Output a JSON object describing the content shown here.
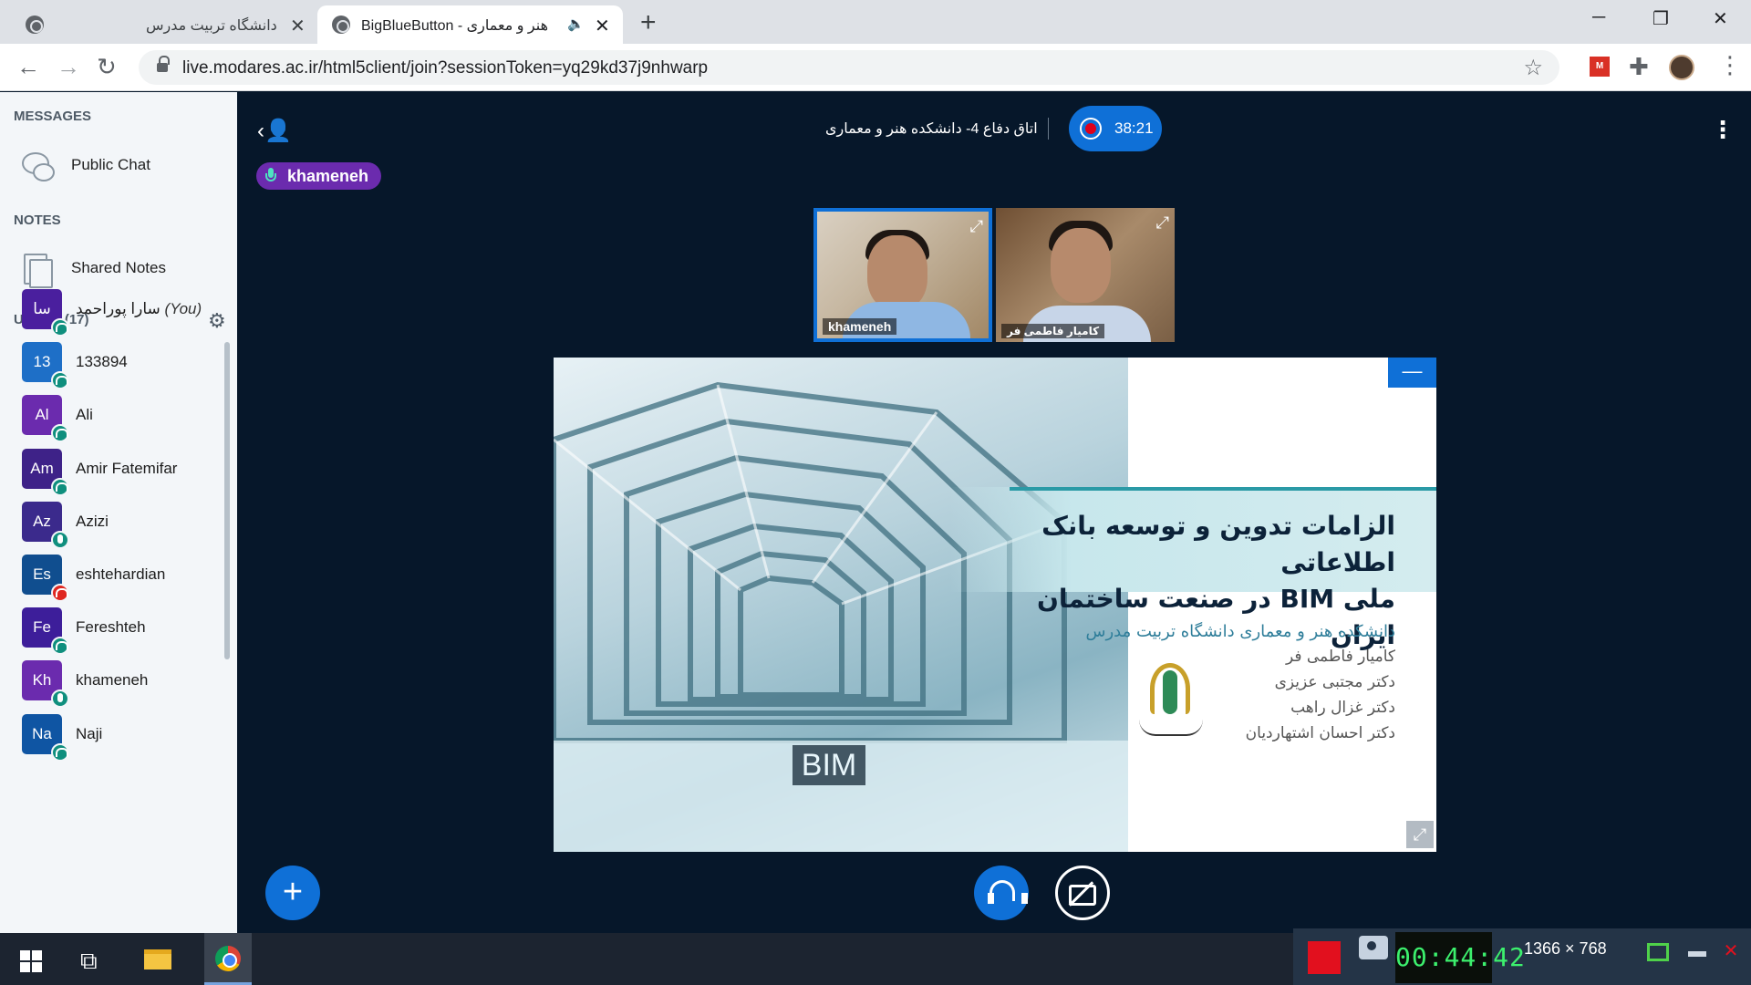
{
  "browser": {
    "tabs": [
      {
        "title": "دانشگاه تربیت مدرس",
        "active": false
      },
      {
        "title": "BigBlueButton - هنر و معماری",
        "active": true
      }
    ],
    "new_tab_icon": "+",
    "url": "live.modares.ac.ir/html5client/join?sessionToken=yq29kd37j9nhwarp",
    "window_controls": {
      "minimize": "─",
      "restore": "❐",
      "close": "✕"
    },
    "ext_label": "M"
  },
  "sidebar": {
    "messages_title": "MESSAGES",
    "public_chat": "Public Chat",
    "notes_title": "NOTES",
    "shared_notes": "Shared Notes",
    "users_title": "USERS (17)",
    "users": [
      {
        "initials": "سا",
        "name": "سارا پوراحمد",
        "you": "(You)",
        "color": "#4a1f9e",
        "status": "listen"
      },
      {
        "initials": "13",
        "name": "133894",
        "color": "#1e6fc7",
        "status": "listen"
      },
      {
        "initials": "Al",
        "name": "Ali",
        "color": "#6b2bae",
        "status": "listen"
      },
      {
        "initials": "Am",
        "name": "Amir Fatemifar",
        "color": "#3e2288",
        "status": "listen"
      },
      {
        "initials": "Az",
        "name": "Azizi",
        "color": "#3b2a8c",
        "status": "mic"
      },
      {
        "initials": "Es",
        "name": "eshtehardian",
        "color": "#104e8f",
        "status": "muted"
      },
      {
        "initials": "Fe",
        "name": "Fereshteh",
        "color": "#3d1e9a",
        "status": "listen"
      },
      {
        "initials": "Kh",
        "name": "khameneh",
        "color": "#6b2bae",
        "status": "mic"
      },
      {
        "initials": "Na",
        "name": "Naji",
        "color": "#0f55a3",
        "status": "listen"
      }
    ]
  },
  "meeting": {
    "title": "اتاق دفاع 4- دانشکده هنر و معماری",
    "recording_time": "38:21",
    "talking_user": "khameneh",
    "webcams": [
      {
        "name": "khameneh"
      },
      {
        "name": "کامیار فاطمی فر"
      }
    ]
  },
  "slide": {
    "title_line1": "الزامات تدوین و توسعه بانک اطلاعاتی",
    "title_line2": "ملی BIM  در صنعت ساختمان ایران",
    "subtitle": "دانشکده هنر و معماری دانشگاه تربیت مدرس",
    "authors": [
      "کامیار فاطمی فر",
      "دکتر مجتبی عزیزی",
      "دکتر غزال راهب",
      "دکتر احسان اشتهاردیان"
    ],
    "tunnel_label": "BIM",
    "minimize_icon": "—",
    "fullscreen_icon": "⤢"
  },
  "taskbar": {
    "clock_display": "00:44:42",
    "resolution": "1366 × 768"
  },
  "colors": {
    "accent": "#0f70d7",
    "talker": "#6b2bae",
    "stage_bg": "#06172a",
    "sidebar_bg": "#f3f6f9"
  }
}
